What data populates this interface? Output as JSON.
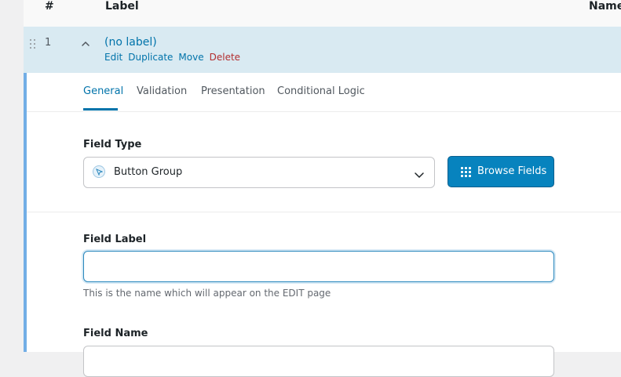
{
  "table_header": {
    "num": "#",
    "label": "Label",
    "name": "Name"
  },
  "field_row": {
    "number": "1",
    "title": "(no label)",
    "actions": {
      "edit": "Edit",
      "duplicate": "Duplicate",
      "move": "Move",
      "delete": "Delete"
    }
  },
  "tabs": {
    "general": "General",
    "validation": "Validation",
    "presentation": "Presentation",
    "conditional_logic": "Conditional Logic",
    "active": "General"
  },
  "field_type": {
    "label": "Field Type",
    "selected": "Button Group",
    "selected_icon": "button-group-icon",
    "dropdown_icon": "chevron-down-icon"
  },
  "browse_button": {
    "label": "Browse Fields",
    "icon": "grid-icon"
  },
  "field_label": {
    "label": "Field Label",
    "value": "",
    "help": "This is the name which will appear on the EDIT page"
  },
  "field_name": {
    "label": "Field Name",
    "value": ""
  },
  "colors": {
    "accent": "#0073aa",
    "row_highlight": "#d9eaf2",
    "delete": "#b32d2e",
    "button_bg": "#0783be",
    "focus_border": "#2a88bd",
    "settings_border": "#72aee6"
  }
}
